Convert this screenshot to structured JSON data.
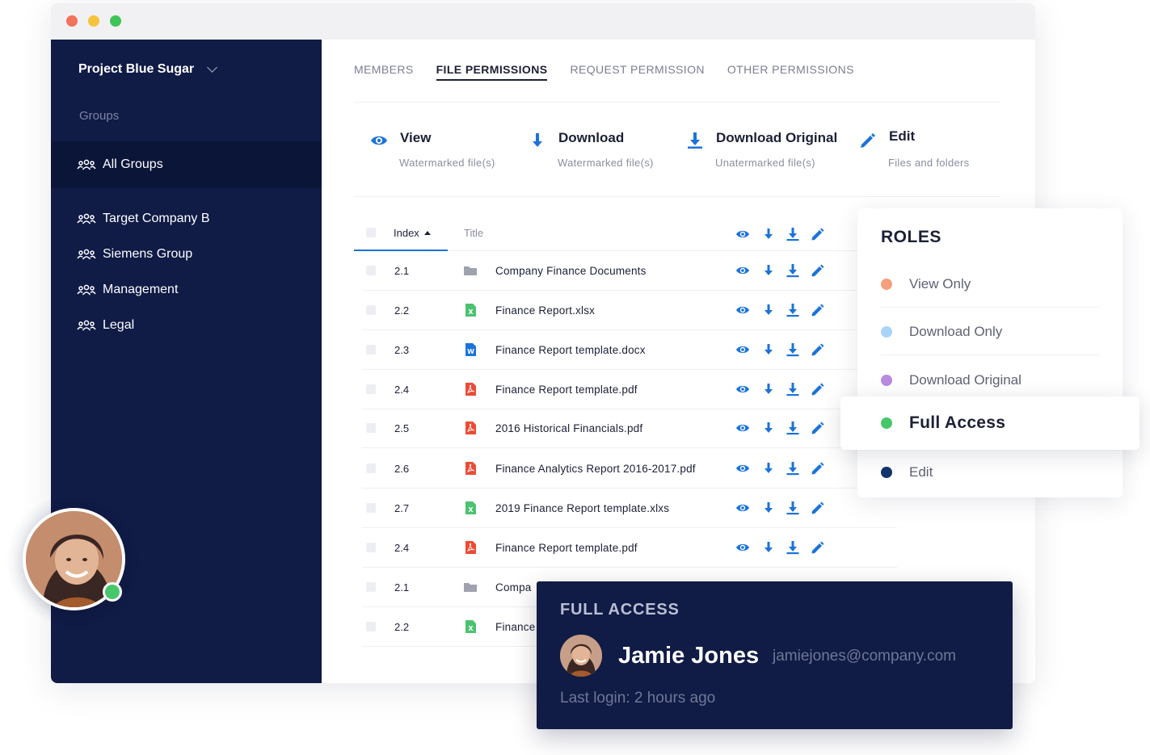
{
  "window": {
    "sidebar": {
      "project_name": "Project Blue Sugar",
      "groups_heading": "Groups",
      "items": [
        {
          "label": "All Groups",
          "active": true
        },
        {
          "label": "Target Company B"
        },
        {
          "label": "Siemens Group"
        },
        {
          "label": "Management"
        },
        {
          "label": "Legal"
        }
      ]
    },
    "tabs": [
      {
        "label": "MEMBERS"
      },
      {
        "label": "FILE PERMISSIONS",
        "active": true
      },
      {
        "label": "REQUEST PERMISSION"
      },
      {
        "label": "OTHER PERMISSIONS"
      }
    ],
    "permissions": [
      {
        "name": "View",
        "desc": "Watermarked file(s)",
        "icon": "eye-icon"
      },
      {
        "name": "Download",
        "desc": "Watermarked file(s)",
        "icon": "download-arrow-icon"
      },
      {
        "name": "Download Original",
        "desc": "Unatermarked file(s)",
        "icon": "download-tray-icon"
      },
      {
        "name": "Edit",
        "desc": "Files and folders",
        "icon": "pencil-icon"
      }
    ],
    "table": {
      "headers": {
        "index": "Index",
        "title": "Title"
      },
      "rows": [
        {
          "index": "2.1",
          "name": "Company Finance Documents",
          "type": "folder"
        },
        {
          "index": "2.2",
          "name": "Finance Report.xlsx",
          "type": "excel"
        },
        {
          "index": "2.3",
          "name": "Finance Report template.docx",
          "type": "word"
        },
        {
          "index": "2.4",
          "name": "Finance Report template.pdf",
          "type": "pdf"
        },
        {
          "index": "2.5",
          "name": "2016 Historical Financials.pdf",
          "type": "pdf"
        },
        {
          "index": "2.6",
          "name": "Finance Analytics Report 2016-2017.pdf",
          "type": "pdf"
        },
        {
          "index": "2.7",
          "name": "2019 Finance Report template.xlxs",
          "type": "excel"
        },
        {
          "index": "2.4",
          "name": "Finance Report template.pdf",
          "type": "pdf"
        },
        {
          "index": "2.1",
          "name": "Compa",
          "type": "folder"
        },
        {
          "index": "2.2",
          "name": "Finance",
          "type": "excel"
        }
      ]
    }
  },
  "roles": {
    "heading": "ROLES",
    "items": [
      {
        "label": "View Only",
        "color": "#f4a07f"
      },
      {
        "label": "Download Only",
        "color": "#a9d3f7"
      },
      {
        "label": "Download Original",
        "color": "#b78bde"
      },
      {
        "label": "Full Access",
        "color": "#47c769",
        "highlighted": true
      },
      {
        "label": "Edit",
        "color": "#14346e"
      }
    ]
  },
  "access_card": {
    "label": "FULL ACCESS",
    "user_name": "Jamie Jones",
    "email": "jamiejones@company.com",
    "last_login": "Last login: 2 hours ago"
  },
  "colors": {
    "sidebar": "#101b46",
    "accent_blue": "#1b73d9",
    "online": "#47c769"
  }
}
